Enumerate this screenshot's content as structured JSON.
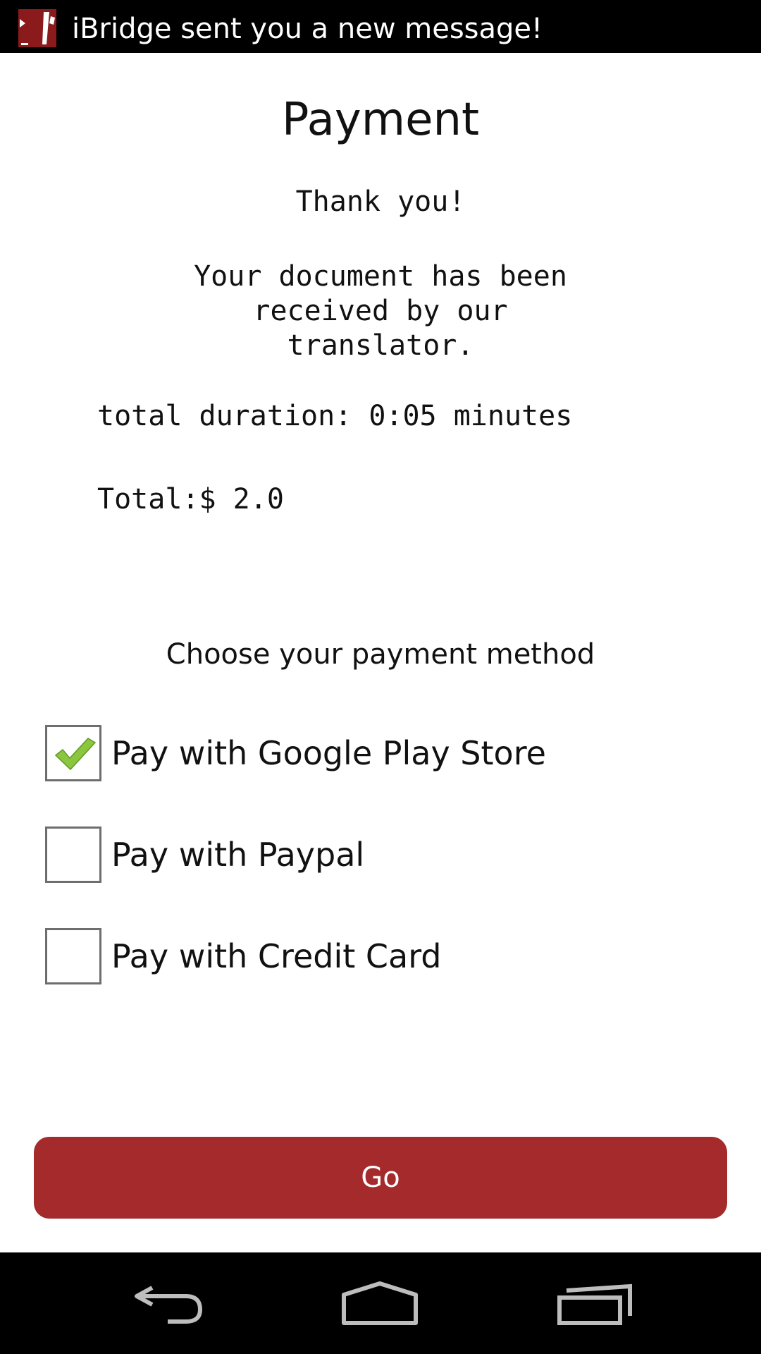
{
  "status_bar": {
    "notification": "iBridge sent you a new message!",
    "icon": "ibridge-app-icon"
  },
  "page": {
    "title": "Payment",
    "thank_you": "Thank you!",
    "received_message": "Your document has been received by our translator.",
    "duration": "total duration: 0:05 minutes",
    "total": "Total:$ 2.0",
    "choose_label": "Choose your payment method"
  },
  "payment_options": [
    {
      "label": "Pay with Google Play Store",
      "checked": true
    },
    {
      "label": "Pay with Paypal",
      "checked": false
    },
    {
      "label": "Pay with Credit Card",
      "checked": false
    }
  ],
  "go_button": {
    "label": "Go"
  },
  "colors": {
    "accent": "#a42a2c",
    "check": "#8cc63f"
  },
  "nav_bar": {
    "icons": [
      "back-icon",
      "home-icon",
      "recent-apps-icon"
    ]
  }
}
